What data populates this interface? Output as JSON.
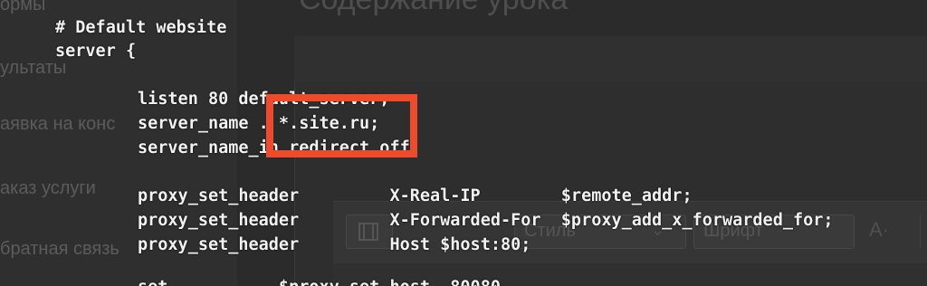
{
  "background_page": {
    "sidebar": {
      "items": [
        {
          "label": "ормы"
        },
        {
          "label": "ультаты"
        },
        {
          "label": "аявка на конс"
        },
        {
          "label": "аказ услуги"
        },
        {
          "label": "братная связь"
        }
      ]
    },
    "heading": "Содержание урока",
    "toolbar": {
      "style_label": "Стиль",
      "font_label": "Шрифт",
      "text_size_glyph": "A·",
      "chevron_glyph": "⌄",
      "film_icon": "film-icon"
    }
  },
  "code": {
    "lines": [
      "# Default website",
      "server {",
      "listen 80 default_server;",
      "server_name . *.site.ru;",
      "server_name_in_redirect off",
      "proxy_set_header         X-Real-IP        $remote_addr;",
      "proxy_set_header         X-Forwarded-For  $proxy_add_x_forwarded_for;",
      "proxy_set_header         Host $host:80;",
      "set           $proxy_set_host  80080"
    ]
  },
  "annotation": {
    "color": "#ef4a2c"
  }
}
